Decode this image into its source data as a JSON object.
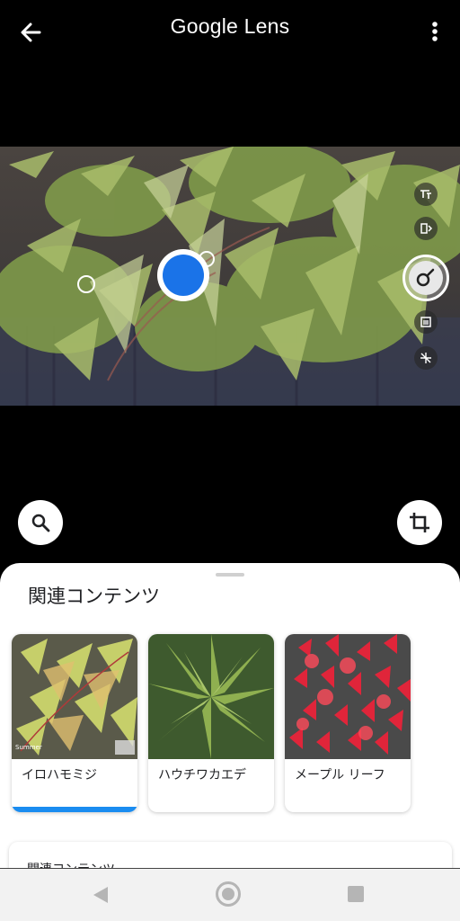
{
  "header": {
    "title": "Google Lens",
    "back_icon": "arrow-left-icon",
    "more_icon": "more-vert-icon"
  },
  "camera": {
    "side_tools": [
      "translate-icon",
      "text-icon",
      "search-mode-icon",
      "shopping-icon",
      "dining-icon"
    ],
    "shutter_icon": "lens-search-icon"
  },
  "actions": {
    "search_icon": "search-icon",
    "crop_icon": "crop-icon"
  },
  "results": {
    "title": "関連コンテンツ",
    "cards": [
      {
        "label": "イロハモミジ",
        "image_caption": "Summer",
        "selected": true
      },
      {
        "label": "ハウチワカエデ",
        "selected": false
      },
      {
        "label": "メープル リーフ",
        "selected": false
      }
    ],
    "second_section_title": "関連コンテンツ"
  },
  "colors": {
    "accent": "#1a73e8",
    "selected_bar": "#1a8cf0"
  }
}
